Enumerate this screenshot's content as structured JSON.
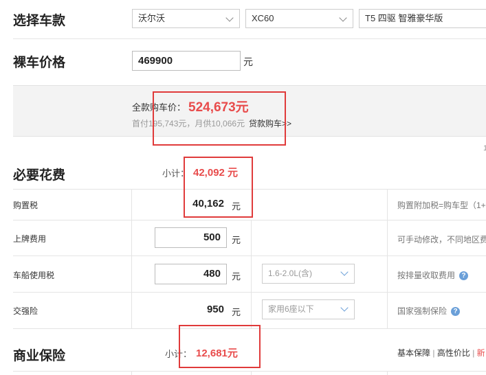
{
  "car_select": {
    "title": "选择车款",
    "brand": "沃尔沃",
    "series": "XC60",
    "model": "T5 四驱 智雅豪华版"
  },
  "bare_price": {
    "title": "裸车价格",
    "value": "469900",
    "unit": "元"
  },
  "summary": {
    "total_label": "全款购车价：",
    "total_value": "524,673元",
    "sub_text": "首付195,743元，月供10,066元",
    "loan_link": "贷款购车>>",
    "edge_digit": "1"
  },
  "required": {
    "title": "必要花费",
    "subtotal_label": "小计：",
    "subtotal_value": "42,092 元",
    "rows": [
      {
        "label": "购置税",
        "value": "40,162",
        "unit": "元",
        "note": "购置附加税=购车型（1+"
      },
      {
        "label": "上牌费用",
        "value": "500",
        "unit": "元",
        "note": "可手动修改，不同地区费"
      },
      {
        "label": "车船使用税",
        "value": "480",
        "unit": "元",
        "select": "1.6-2.0L(含)",
        "note": "按排量收取费用"
      },
      {
        "label": "交强险",
        "value": "950",
        "unit": "元",
        "select": "家用6座以下",
        "note": "国家强制保险"
      }
    ]
  },
  "commercial": {
    "title": "商业保险",
    "subtotal_label": "小计：",
    "subtotal_value": "12,681元",
    "links": [
      "基本保障",
      "高性价比",
      "新"
    ]
  },
  "colors": {
    "accent_red": "#e84b4b",
    "highlight_box": "#e03a3a",
    "help_icon": "#6a9fd8"
  }
}
